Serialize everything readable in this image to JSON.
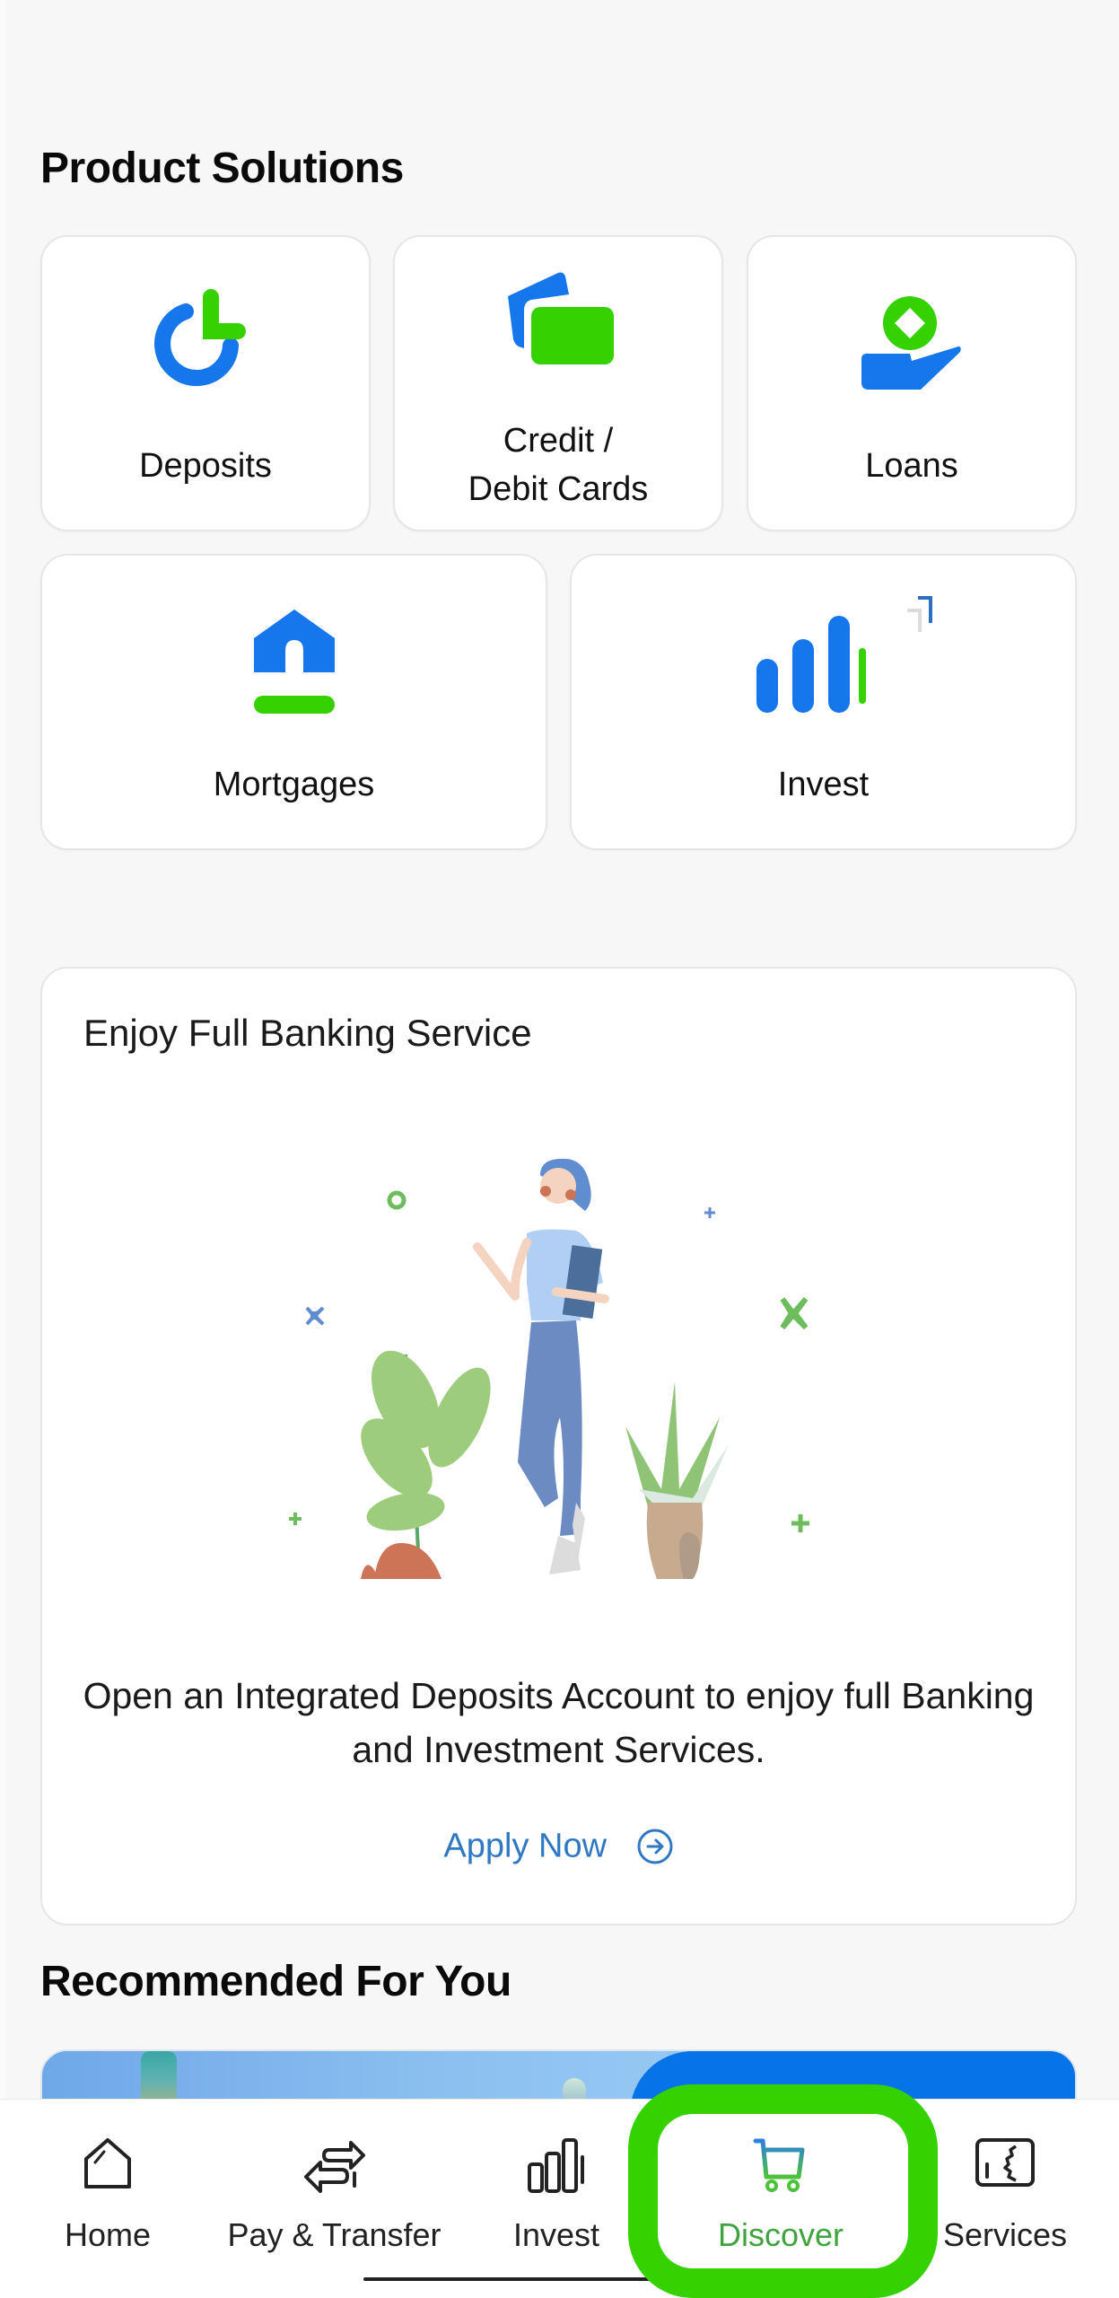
{
  "product_solutions": {
    "title": "Product Solutions",
    "tiles": [
      {
        "id": "deposits",
        "label": "Deposits",
        "icon": "deposits-icon"
      },
      {
        "id": "cards",
        "label_line1": "Credit /",
        "label_line2": "Debit Cards",
        "icon": "cards-icon"
      },
      {
        "id": "loans",
        "label": "Loans",
        "icon": "loan-hand-coin-icon"
      },
      {
        "id": "mortgages",
        "label": "Mortgages",
        "icon": "house-icon"
      },
      {
        "id": "invest",
        "label": "Invest",
        "icon": "bar-chart-icon"
      }
    ]
  },
  "banking_card": {
    "title": "Enjoy Full Banking Service",
    "description": "Open an Integrated Deposits Account to enjoy full Banking and Investment Services.",
    "cta_label": "Apply Now",
    "cta_icon": "arrow-right-circle-icon"
  },
  "recommended": {
    "title": "Recommended For You"
  },
  "bottom_nav": {
    "active": "Discover",
    "items": [
      {
        "label": "Home",
        "icon": "home-icon"
      },
      {
        "label": "Pay & Transfer",
        "icon": "transfer-arrows-icon"
      },
      {
        "label": "Invest",
        "icon": "bar-chart-icon"
      },
      {
        "label": "Discover",
        "icon": "shopping-cart-icon"
      },
      {
        "label": "Services",
        "icon": "services-gear-icon"
      }
    ]
  },
  "colors": {
    "brand_blue": "#1577eb",
    "brand_green": "#36d100",
    "link_blue": "#2f78c4",
    "active_nav_green": "#3fa33f",
    "background": "#f7f7f7"
  }
}
